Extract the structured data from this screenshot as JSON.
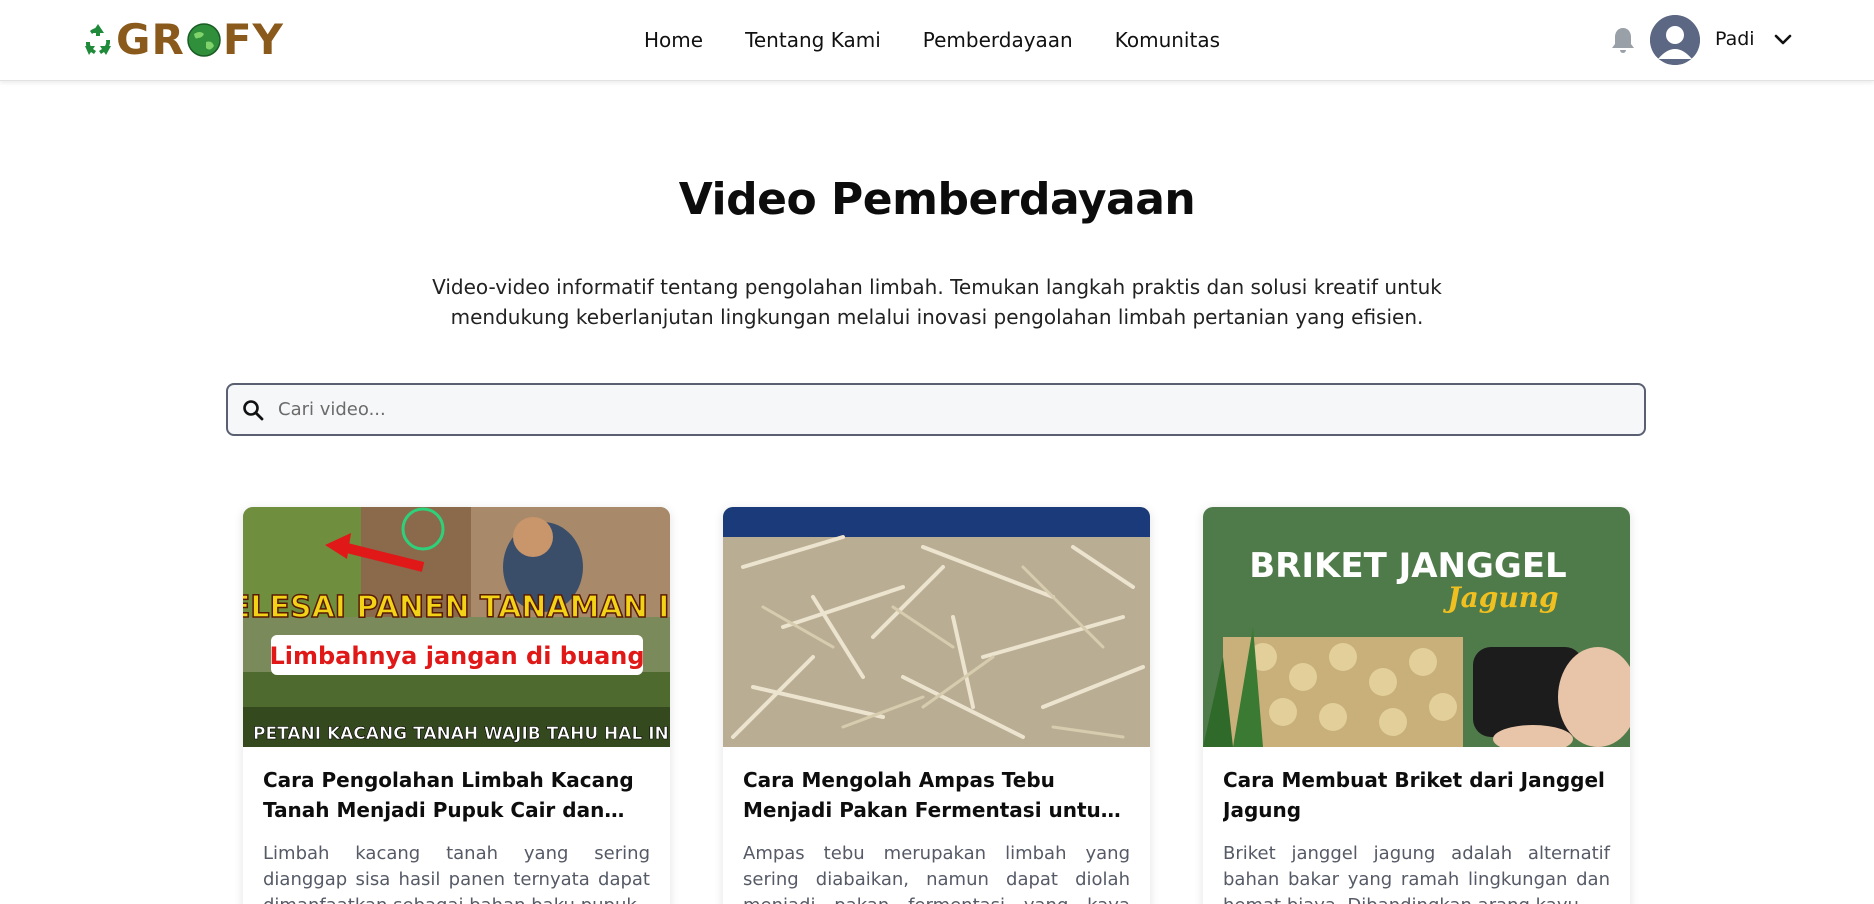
{
  "brand": {
    "logo_text": "GROFY",
    "logo_color": "#8a5a1c",
    "logo_icon": "recycle-icon"
  },
  "nav": {
    "home": "Home",
    "tentang": "Tentang Kami",
    "pemberdayaan": "Pemberdayaan",
    "komunitas": "Komunitas"
  },
  "user": {
    "name": "Padi",
    "notification_icon": "bell-icon",
    "menu_icon": "chevron-down-icon"
  },
  "hero": {
    "title": "Video Pemberdayaan",
    "subtitle": "Video-video informatif tentang pengolahan limbah. Temukan langkah praktis dan solusi kreatif untuk mendukung keberlanjutan lingkungan melalui inovasi pengolahan limbah pertanian yang efisien."
  },
  "search": {
    "placeholder": "Cari video...",
    "value": ""
  },
  "videos": [
    {
      "title": "Cara Pengolahan Limbah Kacang Tanah Menjadi Pupuk Cair dan Pupuk Organik",
      "description": "Limbah kacang tanah yang sering dianggap sisa hasil panen ternyata dapat dimanfaatkan sebagai bahan baku pupuk.",
      "thumbnail_text": {
        "headline": "SELESAI PANEN TANAMAN INI",
        "subheadline": "Limbahnya jangan di buang",
        "footer": "PETANI KACANG TANAH WAJIB TAHU HAL INI..!!!"
      }
    },
    {
      "title": "Cara Mengolah Ampas Tebu Menjadi Pakan Fermentasi untuk Ternak",
      "description": "Ampas tebu merupakan limbah yang sering diabaikan, namun dapat diolah menjadi pakan fermentasi yang kaya nutrisi.",
      "thumbnail_text": {}
    },
    {
      "title": "Cara Membuat Briket dari Janggel Jagung",
      "description": "Briket janggel jagung adalah alternatif bahan bakar yang ramah lingkungan dan hemat biaya. Dibandingkan arang kayu.",
      "thumbnail_text": {
        "headline": "BRIKET JANGGEL",
        "script": "Jagung"
      }
    }
  ],
  "colors": {
    "accent_green": "#1f8a3a",
    "text_dark": "#111111",
    "muted": "#555a66"
  }
}
